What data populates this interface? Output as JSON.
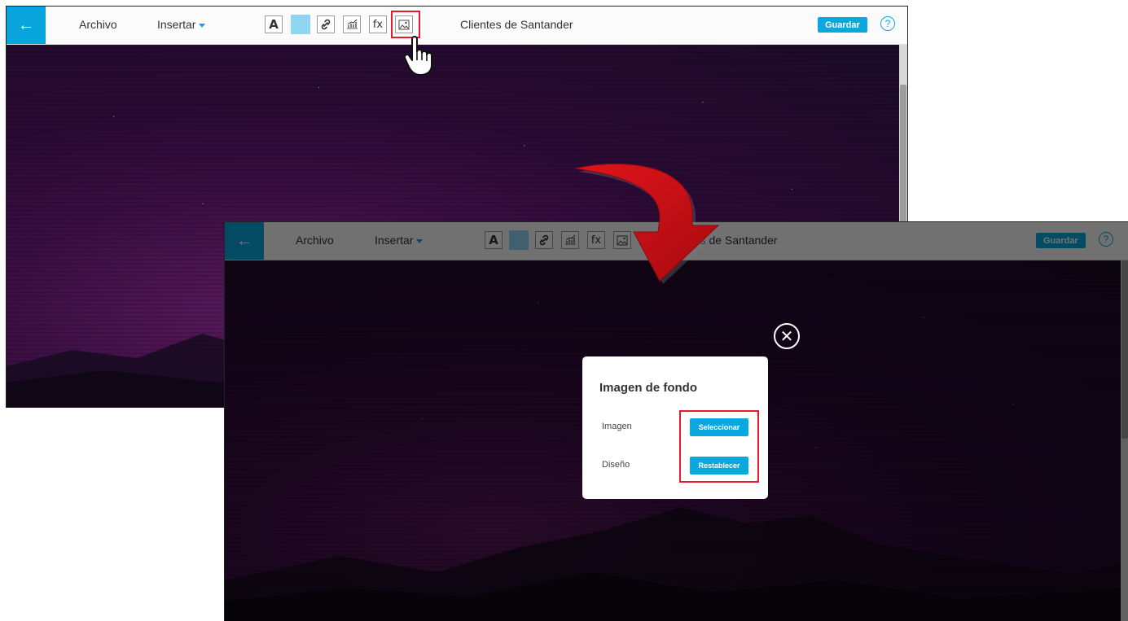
{
  "toolbar": {
    "back_icon": "arrow-left-icon",
    "menu_file": "Archivo",
    "menu_insert": "Insertar",
    "tools": {
      "text_format": "A",
      "color_swatch": "#8fd6f2",
      "link_icon": "link-icon",
      "chart_icon": "chart-icon",
      "formula": "fx",
      "image_icon": "image-icon"
    },
    "doc_title": "Clientes de Santander",
    "save_label": "Guardar",
    "help": "?"
  },
  "dialog": {
    "title": "Imagen de fondo",
    "rows": [
      {
        "label": "Imagen",
        "button": "Seleccionar"
      },
      {
        "label": "Diseño",
        "button": "Restablecer"
      }
    ],
    "close_icon": "close-icon"
  },
  "colors": {
    "accent": "#09a9e0",
    "highlight": "#e8192c",
    "arrow": "#c40d12"
  }
}
